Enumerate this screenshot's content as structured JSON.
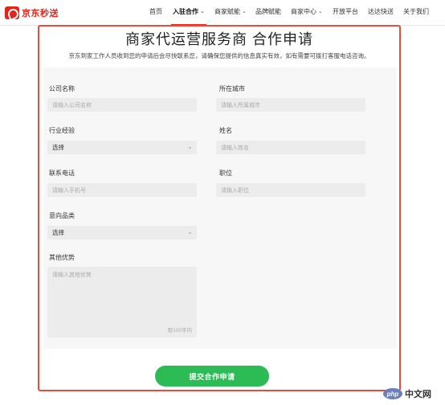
{
  "header": {
    "logo_text": "京东秒送",
    "nav": [
      {
        "label": "首页",
        "dropdown": false,
        "active": false
      },
      {
        "label": "入驻合作",
        "dropdown": true,
        "active": true
      },
      {
        "label": "商家赋能",
        "dropdown": true,
        "active": false
      },
      {
        "label": "品牌赋能",
        "dropdown": false,
        "active": false
      },
      {
        "label": "商家中心",
        "dropdown": true,
        "active": false
      },
      {
        "label": "开放平台",
        "dropdown": false,
        "active": false
      },
      {
        "label": "达达快送",
        "dropdown": false,
        "active": false
      },
      {
        "label": "关于我们",
        "dropdown": false,
        "active": false
      }
    ],
    "accent_color": "#e1251b"
  },
  "form": {
    "title": "商家代运营服务商 合作申请",
    "description": "京东到家工作人员收到您的申请后会尽快联系您，请确保您提供的信息真实有效，如有需要可拨打客服电话咨询。",
    "company_name": {
      "label": "公司名称",
      "placeholder": "请输入公司名称"
    },
    "city": {
      "label": "所在城市",
      "placeholder": "请输入所属城市"
    },
    "industry": {
      "label": "行业经验",
      "value": "选择"
    },
    "name": {
      "label": "姓名",
      "placeholder": "请输入姓名"
    },
    "phone": {
      "label": "联系电话",
      "placeholder": "请输入手机号"
    },
    "position": {
      "label": "职位",
      "placeholder": "请输入职位"
    },
    "category": {
      "label": "意向品类",
      "value": "选择"
    },
    "advantages": {
      "label": "其他优势",
      "placeholder": "请输入其他优势",
      "counter": "限100字内"
    },
    "submit_label": "提交合作申请",
    "submit_color": "#2dbb55",
    "highlight_border_color": "#e74c3c"
  },
  "watermark": {
    "badge": "php",
    "text": "中文网"
  }
}
